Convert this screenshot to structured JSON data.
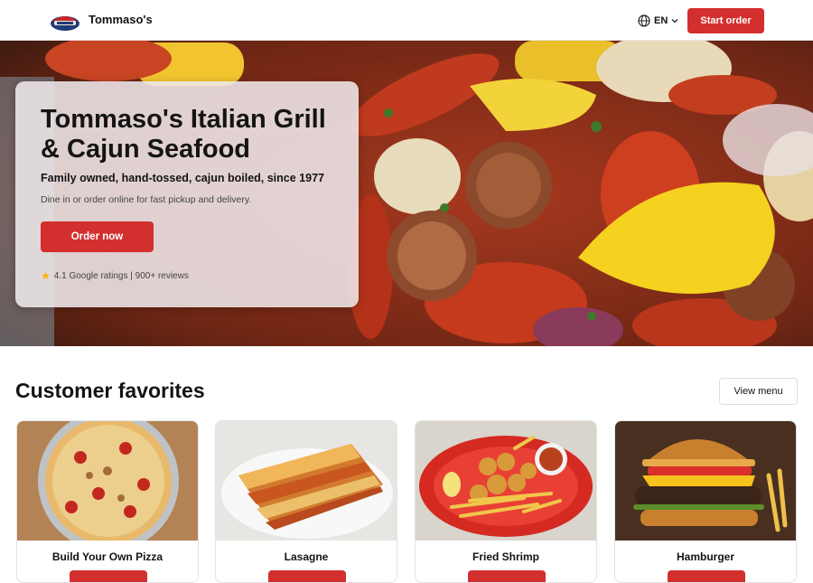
{
  "header": {
    "brand": "Tommaso's",
    "logo_icon": "tommasos-logo-icon",
    "language": "EN",
    "start_order": "Start order"
  },
  "hero": {
    "title": "Tommaso's Italian Grill & Cajun Seafood",
    "subtitle": "Family owned, hand-tossed, cajun boiled, since 1977",
    "description": "Dine in or order online for fast pickup and delivery.",
    "order_now": "Order now",
    "rating_text": "4.1 Google ratings | 900+ reviews"
  },
  "favorites": {
    "title": "Customer favorites",
    "view_menu": "View menu",
    "items": [
      {
        "name": "Build Your Own Pizza",
        "image": "pizza-image"
      },
      {
        "name": "Lasagne",
        "image": "lasagne-image"
      },
      {
        "name": "Fried Shrimp",
        "image": "fried-shrimp-image"
      },
      {
        "name": "Hamburger",
        "image": "hamburger-image"
      }
    ]
  },
  "colors": {
    "accent": "#d32f2f",
    "text": "#141414"
  }
}
